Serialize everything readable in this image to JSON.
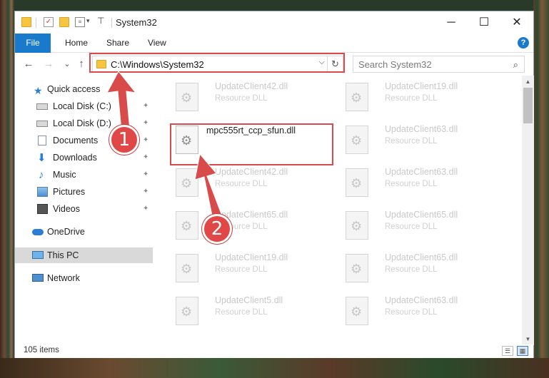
{
  "window": {
    "title": "System32",
    "controls": {
      "minimize": "─",
      "maximize": "☐",
      "close": "✕"
    }
  },
  "ribbon": {
    "tabs": [
      "File",
      "Home",
      "Share",
      "View"
    ],
    "help": "?"
  },
  "nav": {
    "back": "←",
    "forward": "→",
    "recent": "⌄",
    "up": "↑",
    "address": "C:\\Windows\\System32",
    "address_dropdown": "⌵",
    "refresh": "↻",
    "search_placeholder": "Search System32",
    "search_icon": "⌕"
  },
  "sidebar": {
    "items": [
      {
        "label": "Quick access",
        "icon": "star-icon",
        "pinned": false
      },
      {
        "label": "Local Disk (C:)",
        "icon": "drive-icon",
        "pinned": true
      },
      {
        "label": "Local Disk (D:)",
        "icon": "drive-icon",
        "pinned": true
      },
      {
        "label": "Documents",
        "icon": "documents-icon",
        "pinned": true
      },
      {
        "label": "Downloads",
        "icon": "downloads-icon",
        "pinned": true
      },
      {
        "label": "Music",
        "icon": "music-icon",
        "pinned": true
      },
      {
        "label": "Pictures",
        "icon": "pictures-icon",
        "pinned": true
      },
      {
        "label": "Videos",
        "icon": "videos-icon",
        "pinned": true
      },
      {
        "label": "OneDrive",
        "icon": "cloud-icon",
        "pinned": false
      },
      {
        "label": "This PC",
        "icon": "computer-icon",
        "pinned": false,
        "selected": true
      },
      {
        "label": "Network",
        "icon": "network-icon",
        "pinned": false
      }
    ],
    "pin_glyph": "📌"
  },
  "files": [
    {
      "name": "UpdateClient42.dll",
      "type": "Resource DLL"
    },
    {
      "name": "UpdateClient19.dll",
      "type": "Resource DLL"
    },
    {
      "name": "mpc555rt_ccp_sfun.dll",
      "type": "",
      "highlighted": true
    },
    {
      "name": "UpdateClient63.dll",
      "type": "Resource DLL"
    },
    {
      "name": "UpdateClient42.dll",
      "type": "Resource DLL"
    },
    {
      "name": "UpdateClient63.dll",
      "type": "Resource DLL"
    },
    {
      "name": "UpdateClient65.dll",
      "type": "Resource DLL"
    },
    {
      "name": "UpdateClient65.dll",
      "type": "Resource DLL"
    },
    {
      "name": "UpdateClient19.dll",
      "type": "Resource DLL"
    },
    {
      "name": "UpdateClient65.dll",
      "type": "Resource DLL"
    },
    {
      "name": "UpdateClient5.dll",
      "type": "Resource DLL"
    },
    {
      "name": "UpdateClient63.dll",
      "type": "Resource DLL"
    }
  ],
  "status": {
    "item_count": "105 items",
    "view_details": "☰",
    "view_tiles": "▦"
  },
  "annotations": {
    "step1": "1",
    "step2": "2",
    "color": "#d94b4b"
  },
  "colors": {
    "accent": "#1979ca",
    "selected_bg": "#d9d9d9"
  }
}
